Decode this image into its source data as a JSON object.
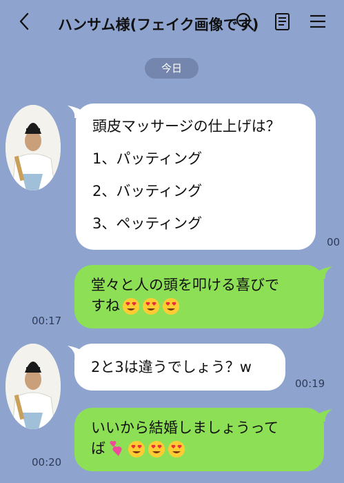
{
  "header": {
    "back_icon": "chevron-left-icon",
    "title": "ハンサム様(フェイク画像です)",
    "search_icon": "search-icon",
    "notes_icon": "notes-icon",
    "menu_icon": "hamburger-menu-icon"
  },
  "date_chip": "今日",
  "messages": [
    {
      "side": "received",
      "lines": [
        "頭皮マッサージの仕上げは？",
        "1、パッティング",
        "2、バッティング",
        "3、ペッティング"
      ],
      "time": "00"
    },
    {
      "side": "sent",
      "lines": [
        "堂々と人の頭を叩ける喜びで",
        "すね"
      ],
      "emoji": [
        "heart-eyes-emoji",
        "heart-eyes-emoji",
        "heart-eyes-emoji"
      ],
      "time": "00:17"
    },
    {
      "side": "received",
      "lines": [
        "2と3は違うでしょう？w"
      ],
      "time": "00:19"
    },
    {
      "side": "sent",
      "lines": [
        "いいから結婚しましょうって",
        "ば"
      ],
      "emoji": [
        "two-hearts-emoji",
        "heart-eyes-emoji",
        "heart-eyes-emoji",
        "heart-eyes-emoji"
      ],
      "time": "00:20"
    }
  ],
  "colors": {
    "background": "#8ea4cf",
    "sent_bubble": "#8de055",
    "received_bubble": "#ffffff",
    "date_chip": "#7486ad"
  }
}
